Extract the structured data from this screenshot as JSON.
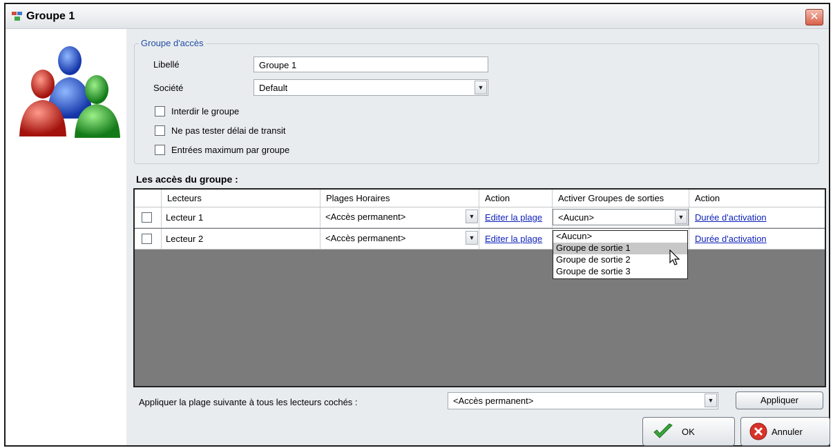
{
  "window": {
    "title": "Groupe 1"
  },
  "access_group": {
    "legend": "Groupe d'accès",
    "label_caption": "Libellé",
    "label_value": "Groupe 1",
    "company_caption": "Société",
    "company_value": "Default",
    "options": [
      {
        "label": "Interdir le groupe",
        "checked": false
      },
      {
        "label": "Ne pas tester délai de transit",
        "checked": false
      },
      {
        "label": "Entrées maximum par groupe",
        "checked": false
      }
    ]
  },
  "readers_section": {
    "title": "Les accès du groupe :",
    "columns": [
      "Lecteurs",
      "Plages Horaires",
      "Action",
      "Activer Groupes de sorties",
      "Action"
    ],
    "rows": [
      {
        "checked": false,
        "reader": "Lecteur 1",
        "schedule": "<Accès permanent>",
        "action": "Editer la plage",
        "output_group": "<Aucun>",
        "action2": "Durée d'activation"
      },
      {
        "checked": false,
        "reader": "Lecteur 2",
        "schedule": "<Accès permanent>",
        "action": "Editer la plage",
        "output_group": "",
        "action2": "Durée d'activation"
      }
    ],
    "output_group_options": [
      "<Aucun>",
      "Groupe de sortie 1",
      "Groupe de sortie 2",
      "Groupe de sortie 3"
    ],
    "output_group_highlighted": "Groupe de sortie 1"
  },
  "footer": {
    "apply_caption": "Appliquer la plage suivante à tous les lecteurs cochés :",
    "apply_value": "<Accès permanent>",
    "apply_button": "Appliquer",
    "ok_button": "OK",
    "cancel_button": "Annuler"
  }
}
